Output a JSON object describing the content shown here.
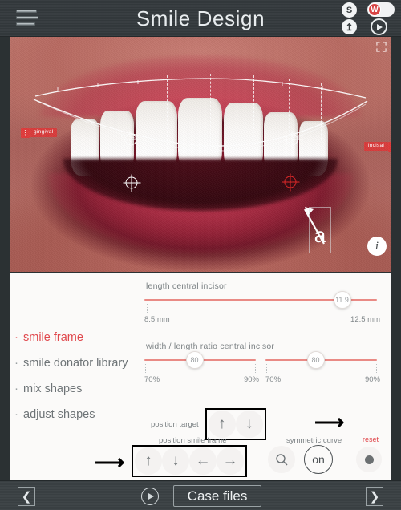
{
  "header": {
    "title": "Smile Design",
    "menu_icon": "hamburger-icon",
    "icons": {
      "share": "S",
      "whitening_badge": "W",
      "upload": "↥",
      "play": "play-icon"
    }
  },
  "photo": {
    "left_tag": {
      "marker": "⋮",
      "label": "gingival"
    },
    "right_tag": {
      "label": "incisal",
      "marker": "⋮"
    },
    "annotation_letter": "a",
    "info_icon": "i",
    "expand_icon": "expand-icon"
  },
  "menu": {
    "items": [
      {
        "label": "smile frame",
        "active": true
      },
      {
        "label": "smile donator library",
        "active": false
      },
      {
        "label": "mix shapes",
        "active": false
      },
      {
        "label": "adjust shapes",
        "active": false
      }
    ]
  },
  "sliders": {
    "length": {
      "title": "length central incisor",
      "value": "11.9",
      "value_pct": 85,
      "min_label": "8.5 mm",
      "max_label": "12.5 mm"
    },
    "ratio": {
      "title": "width / length ratio central incisor",
      "left": {
        "value": "80",
        "value_pct": 45,
        "min_label": "70%",
        "max_label": "90%"
      },
      "right": {
        "value": "80",
        "value_pct": 45,
        "min_label": "70%",
        "max_label": "90%"
      }
    }
  },
  "controls": {
    "position_target": {
      "label": "position target",
      "buttons": [
        "↑",
        "↓"
      ]
    },
    "position_smile_frame": {
      "label": "position smile frame",
      "buttons": [
        "↑",
        "↓",
        "←",
        "→"
      ]
    },
    "search_icon": "search-icon",
    "symmetric_curve": {
      "label": "symmetric curve",
      "state": "on"
    },
    "reset": {
      "label": "reset",
      "icon": "dot-icon"
    }
  },
  "footer": {
    "prev": "❮",
    "play": "play-icon",
    "case_files": "Case files",
    "next": "❯"
  },
  "colors": {
    "accent_red": "#e0484d",
    "slider_track": "#e98a85",
    "chrome_dark": "#343a3d",
    "panel_bg": "#fbfaf9"
  }
}
